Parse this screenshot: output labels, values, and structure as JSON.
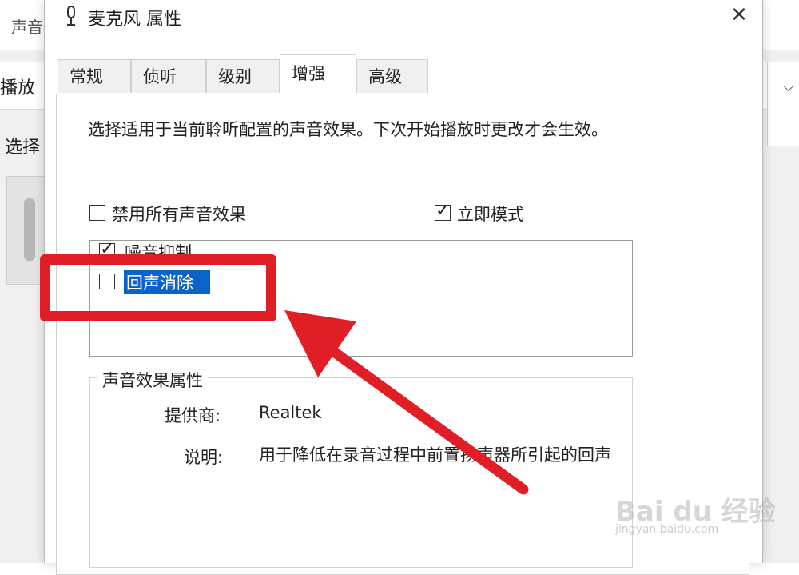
{
  "background_window": {
    "title": "声音",
    "tab_label": "播放",
    "select_label": "选择"
  },
  "dialog": {
    "title": "麦克风 属性",
    "close_label": "✕",
    "tabs": [
      {
        "label": "常规"
      },
      {
        "label": "侦听"
      },
      {
        "label": "级别"
      },
      {
        "label": "增强"
      },
      {
        "label": "高级"
      }
    ],
    "active_tab": "增强",
    "description": "选择适用于当前聆听配置的声音效果。下次开始播放时更改才会生效。",
    "disable_all": {
      "label": "禁用所有声音效果",
      "checked": false
    },
    "immediate_mode": {
      "label": "立即模式",
      "checked": true
    },
    "effects": [
      {
        "label": "噪音抑制",
        "checked": true
      },
      {
        "label": "回声消除",
        "checked": false,
        "selected": true
      }
    ],
    "properties": {
      "legend": "声音效果属性",
      "provider_label": "提供商:",
      "provider_value": "Realtek",
      "description_label": "说明:",
      "description_value": "用于降低在录音过程中前置扬声器所引起的回声"
    }
  },
  "annotation": {
    "color": "#e01e26"
  },
  "watermark": {
    "text": "Bai du 经验",
    "url": "jingyan.baidu.com"
  },
  "colors": {
    "selection": "#0a64c8",
    "annotation": "#e01e26"
  }
}
